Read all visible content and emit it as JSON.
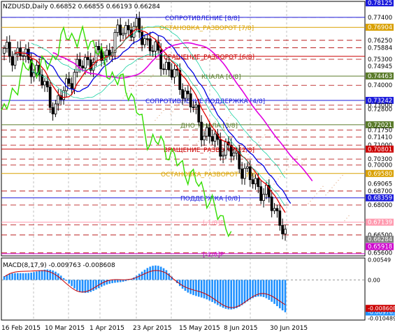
{
  "header": {
    "text": "NZDUSD,Daily  0.66852 0.66855 0.66193 0.66284"
  },
  "murrey_labels": [
    {
      "text": "СОПРОТИВЛЕНИЕ [8/8]",
      "price": 0.774,
      "color": "#1a1adb"
    },
    {
      "text": "ОСТАНОВКА_РАЗВОРОТ [7/8]",
      "price": 0.769,
      "color": "#d9a000"
    },
    {
      "text": "ВРАЩЕНИЕ_РАЗВОРОТ [6/8]",
      "price": 0.7545,
      "color": "#cc0000"
    },
    {
      "text": "КНАЛА [6/8]",
      "price": 0.7446,
      "color": "#5a7b2a"
    },
    {
      "text": "СОПРОТИВЛЕНИЕ ПОДДЕРЖКА [4/8]",
      "price": 0.7324,
      "color": "#1a1adb"
    },
    {
      "text": "ДНО_КНАЛА [3/8]",
      "price": 0.7202,
      "color": "#5a7b2a"
    },
    {
      "text": "ВРАЩЕНИЕ_РАЗВОРОТ [2/8]",
      "price": 0.708,
      "color": "#cc0000"
    },
    {
      "text": "ОСТАНОВКА_РАЗВОРОТ [1/8]",
      "price": 0.6958,
      "color": "#d9a000"
    },
    {
      "text": "ПОДДЕРЖКА [0/8]",
      "price": 0.6836,
      "color": "#1a1adb"
    },
    {
      "text": "[-1/8]P",
      "price": 0.6714,
      "color": "#ff9bb0"
    },
    {
      "text": "[-2/8]P",
      "price": 0.6556,
      "color": "#cc00cc"
    }
  ],
  "price_axis": [
    {
      "label": "0.78125",
      "price": 0.78125,
      "bg": "#1a1adb",
      "fg": "#ffffff"
    },
    {
      "label": "0.77400",
      "price": 0.774,
      "bg": "",
      "fg": "#000"
    },
    {
      "label": "0.76904",
      "price": 0.76904,
      "bg": "#d9a000",
      "fg": "#ffffff"
    },
    {
      "label": "0.76250",
      "price": 0.7625,
      "bg": "",
      "fg": "#000"
    },
    {
      "label": "0.75884",
      "price": 0.75884,
      "bg": "",
      "fg": "#000"
    },
    {
      "label": "0.75300",
      "price": 0.753,
      "bg": "",
      "fg": "#000"
    },
    {
      "label": "0.74945",
      "price": 0.74945,
      "bg": "",
      "fg": "#000"
    },
    {
      "label": "0.74463",
      "price": 0.74463,
      "bg": "#5a7b2a",
      "fg": "#ffffff"
    },
    {
      "label": "0.74000",
      "price": 0.74,
      "bg": "",
      "fg": "#000"
    },
    {
      "label": "0.73242",
      "price": 0.73242,
      "bg": "#1a1adb",
      "fg": "#ffffff"
    },
    {
      "label": "0.73000",
      "price": 0.73,
      "bg": "",
      "fg": "#000"
    },
    {
      "label": "0.72800",
      "price": 0.728,
      "bg": "",
      "fg": "#000"
    },
    {
      "label": "0.72021",
      "price": 0.72021,
      "bg": "#5a7b2a",
      "fg": "#ffffff"
    },
    {
      "label": "0.71750",
      "price": 0.7175,
      "bg": "",
      "fg": "#000"
    },
    {
      "label": "0.71410",
      "price": 0.7141,
      "bg": "",
      "fg": "#000"
    },
    {
      "label": "0.71000",
      "price": 0.71,
      "bg": "",
      "fg": "#000"
    },
    {
      "label": "0.70801",
      "price": 0.70801,
      "bg": "#cc0000",
      "fg": "#ffffff"
    },
    {
      "label": "0.70300",
      "price": 0.703,
      "bg": "",
      "fg": "#000"
    },
    {
      "label": "0.70000",
      "price": 0.7,
      "bg": "",
      "fg": "#000"
    },
    {
      "label": "0.69580",
      "price": 0.6958,
      "bg": "#d9a000",
      "fg": "#ffffff"
    },
    {
      "label": "0.69065",
      "price": 0.69065,
      "bg": "",
      "fg": "#000"
    },
    {
      "label": "0.68700",
      "price": 0.687,
      "bg": "",
      "fg": "#000"
    },
    {
      "label": "0.68359",
      "price": 0.68359,
      "bg": "#1a1adb",
      "fg": "#ffffff"
    },
    {
      "label": "0.68000",
      "price": 0.68,
      "bg": "",
      "fg": "#000"
    },
    {
      "label": "0.67139",
      "price": 0.67139,
      "bg": "#ff9bb0",
      "fg": "#ffffff"
    },
    {
      "label": "0.66500",
      "price": 0.665,
      "bg": "",
      "fg": "#000"
    },
    {
      "label": "0.66284",
      "price": 0.66284,
      "bg": "#808080",
      "fg": "#ffffff"
    },
    {
      "label": "0.65918",
      "price": 0.65918,
      "bg": "#cc00cc",
      "fg": "#ffffff"
    },
    {
      "label": "0.65600",
      "price": 0.656,
      "bg": "",
      "fg": "#000"
    }
  ],
  "red_dashed_levels": [
    0.774,
    0.7625,
    0.7588,
    0.753,
    0.74,
    0.73,
    0.728,
    0.7175,
    0.7141,
    0.71,
    0.703,
    0.7,
    0.687,
    0.68,
    0.67,
    0.665,
    0.656
  ],
  "x_axis": [
    "16 Feb 2015",
    "10 Mar 2015",
    "1 Apr 2015",
    "23 Apr 2015",
    "15 May 2015",
    "8 Jun 2015",
    "30 Jun 2015"
  ],
  "macd": {
    "label": "MACD(8,17,9) -0.009763 -0.008608",
    "axis": [
      {
        "label": "0.00549",
        "val": 0.00549,
        "bg": "",
        "fg": "#000"
      },
      {
        "label": "0.00",
        "val": 0.0,
        "bg": "",
        "fg": "#000"
      },
      {
        "label": "-0.009763",
        "val": -0.0088,
        "bg": "#1e90ff",
        "fg": "#ffffff"
      },
      {
        "label": "-0.008608",
        "val": -0.0078,
        "bg": "#cc0000",
        "fg": "#ffffff"
      },
      {
        "label": "-0.010489",
        "val": -0.010489,
        "bg": "",
        "fg": "#000"
      }
    ]
  },
  "colors": {
    "candles": "#000000",
    "ma_red": "#e00000",
    "ma_blue": "#0000e0",
    "ma_magenta": "#e000e0",
    "ma_green": "#33dd00",
    "envelope": "#00cc99",
    "macd_hist": "#1e90ff",
    "macd_signal": "#cc0000"
  }
}
